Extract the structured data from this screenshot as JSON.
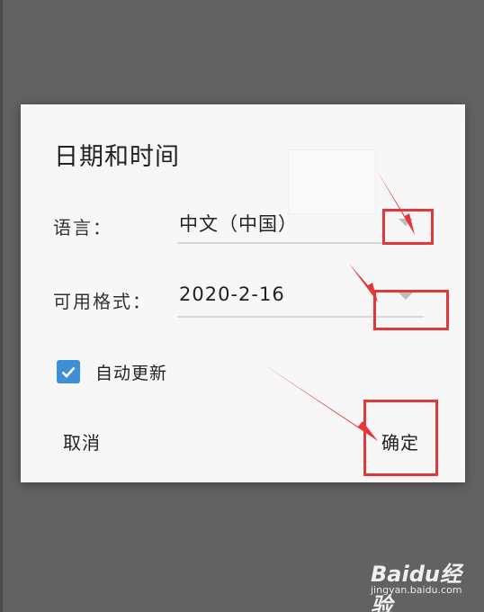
{
  "dialog": {
    "title": "日期和时间",
    "language_label": "语言：",
    "language_value": "中文（中国）",
    "format_label": "可用格式：",
    "format_value": "2020-2-16",
    "auto_update_label": "自动更新",
    "auto_update_checked": true,
    "cancel_label": "取消",
    "ok_label": "确定"
  },
  "annotations": {
    "color": "#e3383a"
  },
  "watermark": {
    "brand": "Baidu经验",
    "url": "jingyan.baidu.com"
  },
  "colors": {
    "backdrop": "#626262",
    "dialog": "#f7f7f7",
    "checkbox": "#3f8fd8"
  }
}
